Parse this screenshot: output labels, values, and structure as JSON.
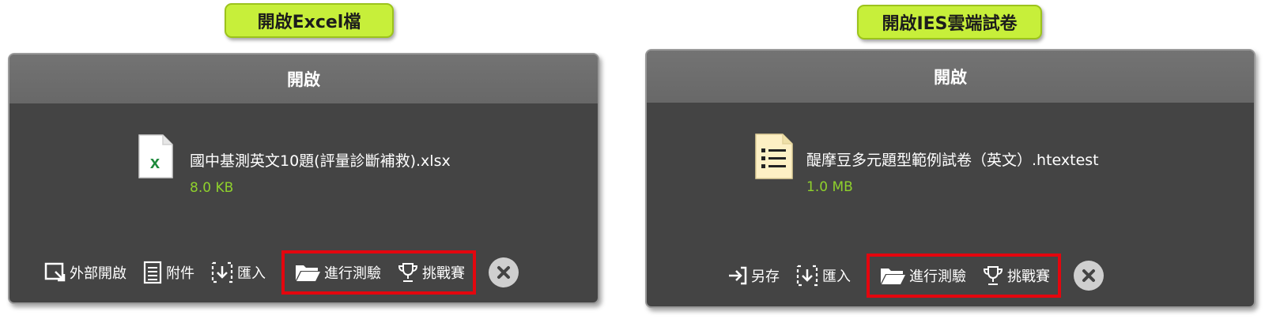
{
  "left": {
    "tag_label": "開啟Excel檔",
    "dialog_title": "開啟",
    "file_name": "國中基測英文10題(評量診斷補救).xlsx",
    "file_size": "8.0 KB",
    "file_icon": "excel-file-icon",
    "actions": {
      "external_open": "外部開啟",
      "attachment": "附件",
      "import": "匯入",
      "start_test": "進行測驗",
      "challenge": "挑戰賽"
    }
  },
  "right": {
    "tag_label": "開啟IES雲端試卷",
    "dialog_title": "開啟",
    "file_name": "醍摩豆多元題型範例試卷（英文）.htextest",
    "file_size": "1.0 MB",
    "file_icon": "test-paper-file-icon",
    "actions": {
      "save_as": "另存",
      "import": "匯入",
      "start_test": "進行測驗",
      "challenge": "挑戰賽"
    }
  },
  "colors": {
    "tag_bg": "#c7ef3a",
    "panel_bg": "#444444",
    "header_bg": "#6e6e6e",
    "size_text": "#8fd12c",
    "highlight": "#e4060e"
  }
}
